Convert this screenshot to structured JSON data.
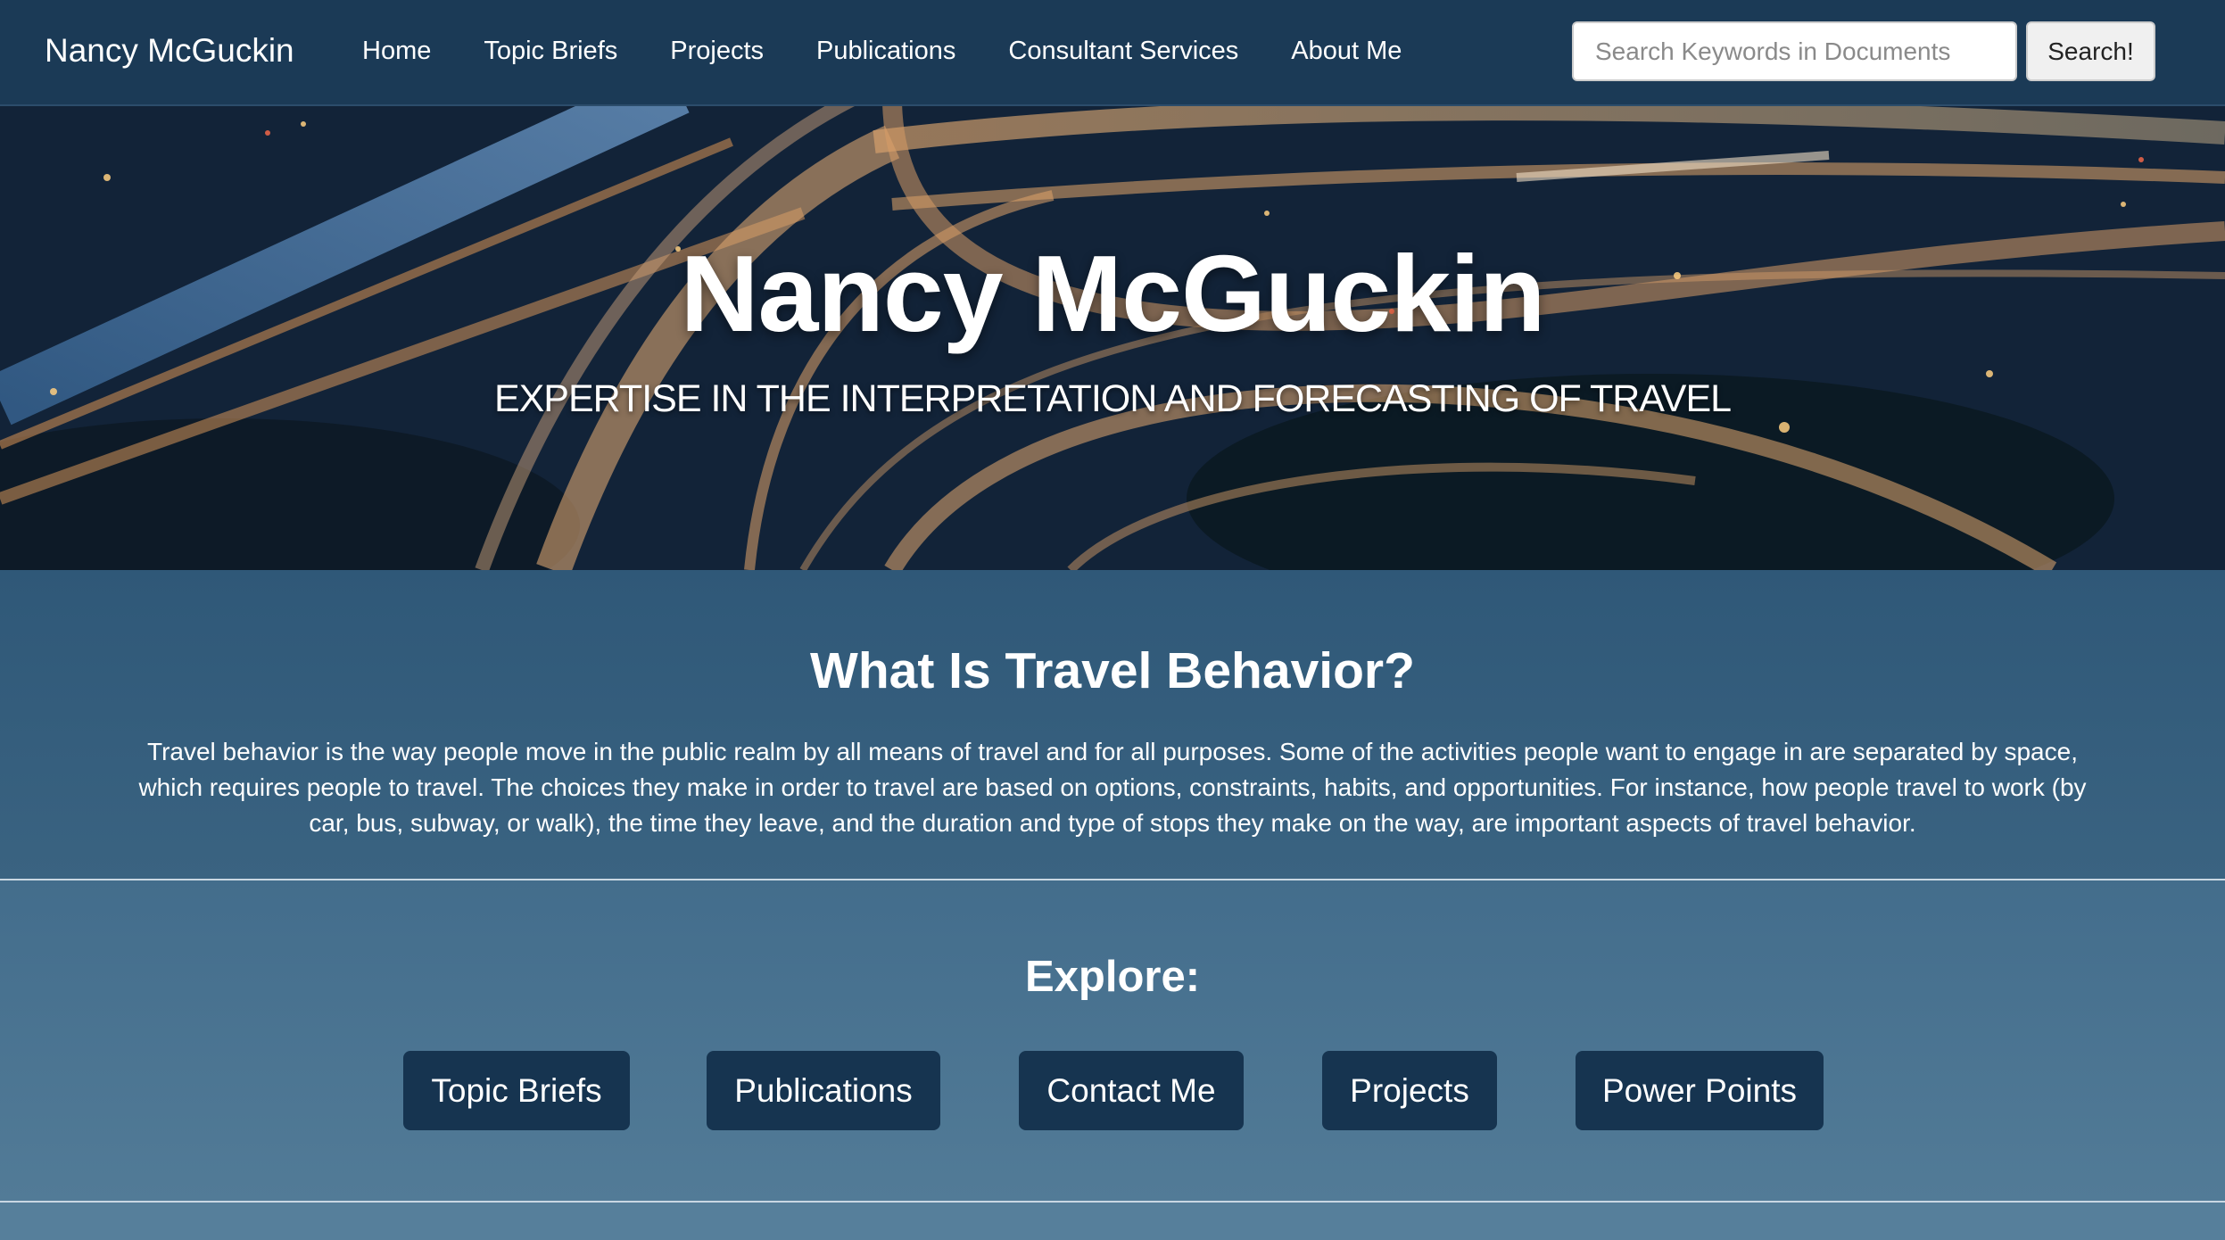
{
  "navbar": {
    "brand": "Nancy McGuckin",
    "links": [
      "Home",
      "Topic Briefs",
      "Projects",
      "Publications",
      "Consultant Services",
      "About Me"
    ],
    "search_placeholder": "Search Keywords in Documents",
    "search_value": "",
    "search_button": "Search!"
  },
  "hero": {
    "title": "Nancy McGuckin",
    "subtitle": "EXPERTISE IN THE INTERPRETATION AND FORECASTING OF TRAVEL"
  },
  "about": {
    "heading": "What Is Travel Behavior?",
    "body": "Travel behavior is the way people move in the public realm by all means of travel and for all purposes. Some of the activities people want to engage in are separated by space, which requires people to travel. The choices they make in order to travel are based on options, constraints, habits, and opportunities. For instance, how people travel to work (by car, bus, subway, or walk), the time they leave, and the duration and type of stops they make on the way, are important aspects of travel behavior."
  },
  "explore": {
    "heading": "Explore:",
    "buttons": [
      "Topic Briefs",
      "Publications",
      "Contact Me",
      "Projects",
      "Power Points"
    ]
  },
  "colors": {
    "navbar_bg": "#1b3a56",
    "button_bg": "#163450",
    "section_bg": "#3a6381"
  }
}
